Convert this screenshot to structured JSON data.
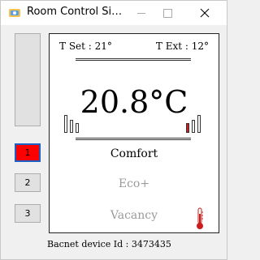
{
  "window": {
    "title": "Room Control Si…"
  },
  "side_buttons": [
    "1",
    "2",
    "3"
  ],
  "panel": {
    "t_set": "T Set : 21°",
    "t_ext": "T Ext : 12°",
    "temperature": "20.8°C",
    "modes": {
      "comfort": "Comfort",
      "eco": "Eco+",
      "vacancy": "Vacancy"
    }
  },
  "status": {
    "bacnet": "Bacnet device Id :  3473435"
  },
  "colors": {
    "active_button": "#ff0000",
    "active_border": "#1d5fc4",
    "heat_bar": "#c81e1e",
    "inactive_mode": "#9a9a9a"
  }
}
